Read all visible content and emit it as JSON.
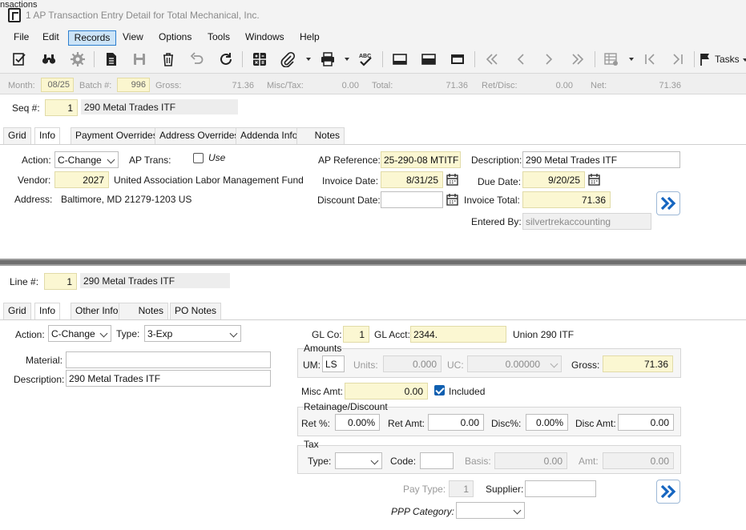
{
  "window": {
    "title": "1 AP Transaction Entry Detail for Total Mechanical, Inc.",
    "bg_fragment": "nsactions"
  },
  "menu": [
    "File",
    "Edit",
    "Records",
    "View",
    "Options",
    "Tools",
    "Windows",
    "Help"
  ],
  "toolbar": {
    "tasks_label": "Tasks"
  },
  "summary": {
    "month_label": "Month:",
    "month": "08/25",
    "batch_label": "Batch #:",
    "batch": "996",
    "gross_label": "Gross:",
    "gross": "71.36",
    "misc_label": "Misc/Tax:",
    "misc": "0.00",
    "total_label": "Total:",
    "total": "71.36",
    "retdisc_label": "Ret/Disc:",
    "retdisc": "0.00",
    "net_label": "Net:",
    "net": "71.36"
  },
  "header": {
    "seq_label": "Seq #:",
    "seq": "1",
    "seq_desc": "290 Metal Trades ITF",
    "tabs": [
      "Grid",
      "Info",
      "Payment Overrides",
      "Address Overrides",
      "Addenda Info",
      "Notes"
    ],
    "action_label": "Action:",
    "action": "C-Change",
    "aptrans_label": "AP Trans:",
    "use_label": "Use",
    "vendor_label": "Vendor:",
    "vendor": "2027",
    "vendor_name": "United Association Labor Management Fund",
    "address_label": "Address:",
    "address": "Baltimore,  MD  21279-1203  US",
    "apref_label": "AP Reference:",
    "apref": "25-290-08 MTITF",
    "invdate_label": "Invoice Date:",
    "invdate": "8/31/25",
    "discdate_label": "Discount Date:",
    "discdate": "",
    "desc_label": "Description:",
    "desc": "290 Metal Trades ITF",
    "duedate_label": "Due Date:",
    "duedate": "9/20/25",
    "invtotal_label": "Invoice Total:",
    "invtotal": "71.36",
    "enteredby_label": "Entered By:",
    "enteredby": "silvertrekaccounting"
  },
  "line": {
    "line_label": "Line #:",
    "line": "1",
    "line_desc": "290 Metal Trades ITF",
    "tabs": [
      "Grid",
      "Info",
      "Other Info",
      "Notes",
      "PO Notes"
    ],
    "action_label": "Action:",
    "action": "C-Change",
    "type_label": "Type:",
    "type": "3-Exp",
    "material_label": "Material:",
    "material": "",
    "desc_label": "Description:",
    "desc": "290 Metal Trades ITF",
    "glco_label": "GL Co:",
    "glco": "1",
    "glacct_label": "GL Acct:",
    "glacct": "2344.",
    "glacct_desc": "Union 290 ITF",
    "amounts_title": "Amounts",
    "um_label": "UM:",
    "um": "LS",
    "units_label": "Units:",
    "units": "0.000",
    "uc_label": "UC:",
    "uc": "0.00000",
    "gross_label": "Gross:",
    "gross": "71.36",
    "misc_label": "Misc Amt:",
    "misc": "0.00",
    "included_label": "Included",
    "ret_title": "Retainage/Discount",
    "retpct_label": "Ret %:",
    "retpct": "0.00%",
    "retamt_label": "Ret Amt:",
    "retamt": "0.00",
    "discpct_label": "Disc%:",
    "discpct": "0.00%",
    "discamt_label": "Disc Amt:",
    "discamt": "0.00",
    "tax_title": "Tax",
    "taxtype_label": "Type:",
    "taxtype": "",
    "code_label": "Code:",
    "code": "",
    "basis_label": "Basis:",
    "basis": "0.00",
    "amt_label": "Amt:",
    "amt": "0.00",
    "paytype_label": "Pay Type:",
    "paytype": "1",
    "supplier_label": "Supplier:",
    "supplier": "",
    "ppp_label": "PPP Category:",
    "ppp": ""
  },
  "colors": {
    "accent": "#0f5fb0",
    "required_bg": "#fbf7d2",
    "menu_active": "#cce4f7"
  }
}
